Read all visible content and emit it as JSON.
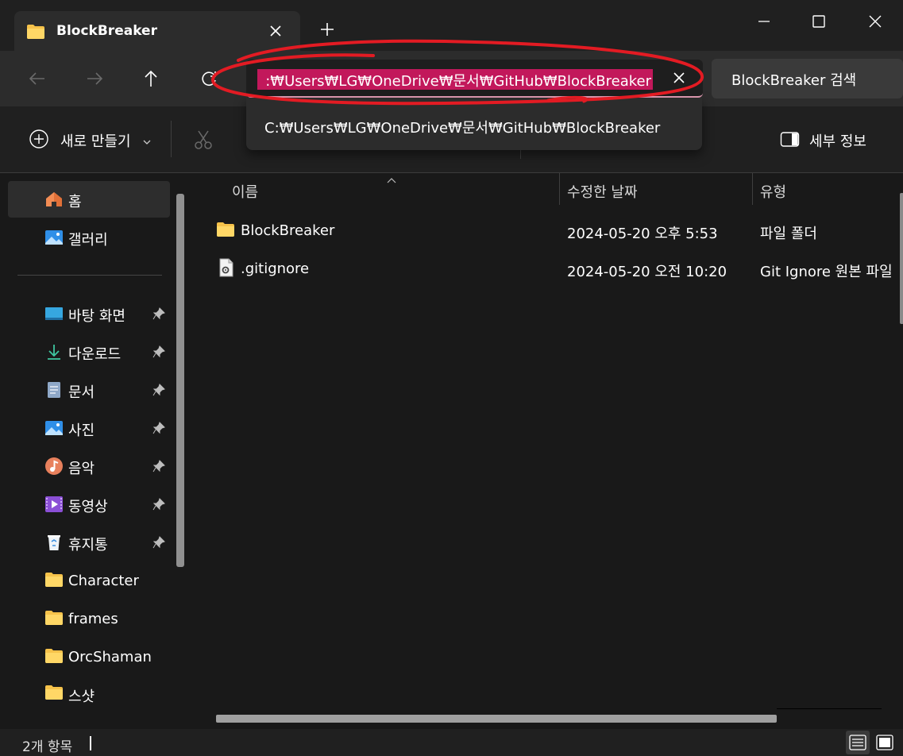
{
  "window": {
    "tab_title": "BlockBreaker",
    "tab_icon": "folder-icon",
    "new_tab_label": "+"
  },
  "nav": {
    "address_text": "C:\\Users\\LG\\OneDrive\\문서\\GitHub\\BlockBreaker",
    "address_display": ":₩Users₩LG₩OneDrive₩문서₩GitHub₩BlockBreaker",
    "search_placeholder": "BlockBreaker 검색",
    "suggestion": "C:₩Users₩LG₩OneDrive₩문서₩GitHub₩BlockBreaker"
  },
  "commandbar": {
    "new_label": "새로 만들기",
    "details_label": "세부 정보"
  },
  "sidebar": {
    "items": [
      {
        "label": "홈",
        "icon": "home-icon",
        "pinned": false
      },
      {
        "label": "갤러리",
        "icon": "gallery-icon",
        "pinned": false
      },
      {
        "label": "바탕 화면",
        "icon": "desktop-icon",
        "pinned": true
      },
      {
        "label": "다운로드",
        "icon": "download-icon",
        "pinned": true
      },
      {
        "label": "문서",
        "icon": "documents-icon",
        "pinned": true
      },
      {
        "label": "사진",
        "icon": "pictures-icon",
        "pinned": true
      },
      {
        "label": "음악",
        "icon": "music-icon",
        "pinned": true
      },
      {
        "label": "동영상",
        "icon": "videos-icon",
        "pinned": true
      },
      {
        "label": "휴지통",
        "icon": "recycle-bin-icon",
        "pinned": true
      },
      {
        "label": "Character",
        "icon": "folder-icon",
        "pinned": false
      },
      {
        "label": "frames",
        "icon": "folder-icon",
        "pinned": false
      },
      {
        "label": "OrcShaman",
        "icon": "folder-icon",
        "pinned": false
      },
      {
        "label": "스샷",
        "icon": "folder-icon",
        "pinned": false
      }
    ]
  },
  "files": {
    "columns": [
      "이름",
      "수정한 날짜",
      "유형"
    ],
    "rows": [
      {
        "name": "BlockBreaker",
        "modified": "2024-05-20 오후 5:53",
        "type": "파일 폴더",
        "icon": "folder-icon"
      },
      {
        "name": ".gitignore",
        "modified": "2024-05-20 오전 10:20",
        "type": "Git Ignore 원본 파일",
        "icon": "settings-file-icon"
      }
    ]
  },
  "status": {
    "item_count": "2개 항목"
  },
  "colors": {
    "accent_selection": "#c2185b",
    "annotation": "#e31b23",
    "folder": "#f6c24a"
  }
}
